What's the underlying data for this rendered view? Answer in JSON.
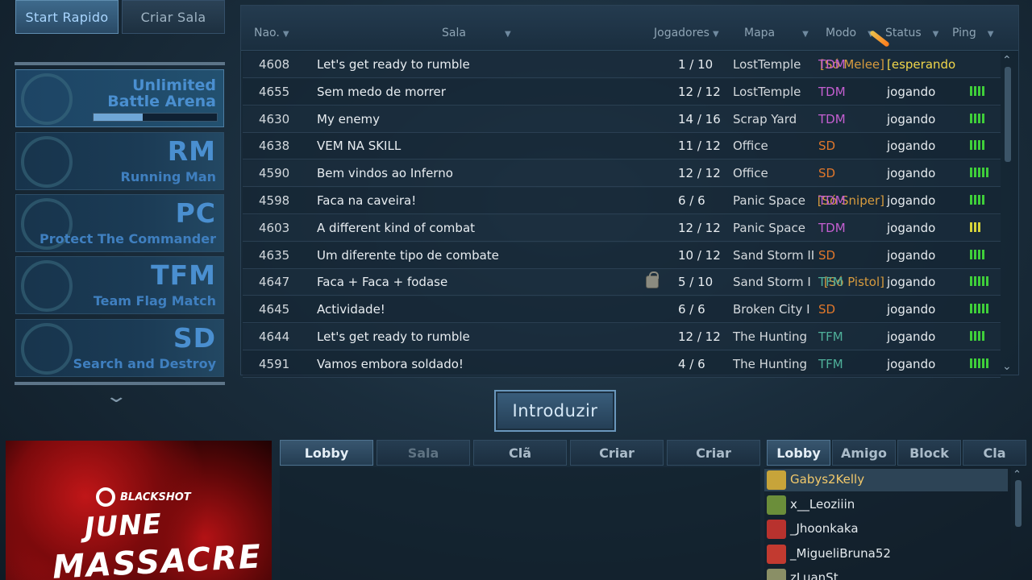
{
  "mode_buttons": {
    "quick_start": "Start Rapido",
    "create_room": "Criar Sala"
  },
  "sidebar": {
    "cards": [
      {
        "line1": "Unlimited",
        "line2": "Battle Arena",
        "progress": 0.4,
        "emblem": "infinity-emblem-icon"
      },
      {
        "big": "RM",
        "sub": "Running Man",
        "emblem": "dollar-pin-icon"
      },
      {
        "big": "PC",
        "sub": "Protect The Commander",
        "emblem": "star-shield-icon"
      },
      {
        "big": "TFM",
        "sub": "Team Flag Match",
        "emblem": "flag-shield-icon"
      },
      {
        "big": "SD",
        "sub": "Search and Destroy",
        "emblem": "bomb-target-icon"
      }
    ]
  },
  "room_table": {
    "headers": {
      "no": "Nao.",
      "room": "Sala",
      "players": "Jogadores",
      "map": "Mapa",
      "mode": "Modo",
      "status": "Status",
      "ping": "Ping"
    },
    "rows": [
      {
        "no": "4608",
        "name": "Let's get ready to rumble",
        "restrict": "[Só Melee]",
        "players": "1 / 10",
        "map": "LostTemple",
        "mode": "TDM",
        "status": "[esperando",
        "ping": 0
      },
      {
        "no": "4655",
        "name": "Sem medo de morrer",
        "restrict": "",
        "players": "12 / 12",
        "map": "LostTemple",
        "mode": "TDM",
        "status": "jogando",
        "ping": 4
      },
      {
        "no": "4630",
        "name": "My enemy",
        "restrict": "",
        "players": "14 / 16",
        "map": "Scrap Yard",
        "mode": "TDM",
        "status": "jogando",
        "ping": 4
      },
      {
        "no": "4638",
        "name": "VEM NA SKILL",
        "restrict": "",
        "players": "11 / 12",
        "map": "Office",
        "mode": "SD",
        "status": "jogando",
        "ping": 4
      },
      {
        "no": "4590",
        "name": "Bem vindos ao Inferno",
        "restrict": "",
        "players": "12 / 12",
        "map": "Office",
        "mode": "SD",
        "status": "jogando",
        "ping": 5
      },
      {
        "no": "4598",
        "name": "Faca na caveira!",
        "restrict": "[Só Sniper]",
        "players": "6 / 6",
        "map": "Panic Space",
        "mode": "TDM",
        "status": "jogando",
        "ping": 4
      },
      {
        "no": "4603",
        "name": "A different kind of combat",
        "restrict": "",
        "players": "12 / 12",
        "map": "Panic Space",
        "mode": "TDM",
        "status": "jogando",
        "ping": 3
      },
      {
        "no": "4635",
        "name": "Um diferente tipo de combate",
        "restrict": "",
        "players": "10 / 12",
        "map": "Sand Storm II",
        "mode": "SD",
        "status": "jogando",
        "ping": 4
      },
      {
        "no": "4647",
        "name": "Faca + Faca + fodase",
        "restrict": "[Só Pistol]",
        "locked": true,
        "players": "5 / 10",
        "map": "Sand Storm I",
        "mode": "TFM",
        "status": "jogando",
        "ping": 5
      },
      {
        "no": "4645",
        "name": "Actividade!",
        "restrict": "",
        "players": "6 / 6",
        "map": "Broken City I",
        "mode": "SD",
        "status": "jogando",
        "ping": 5
      },
      {
        "no": "4644",
        "name": "Let's get ready to rumble",
        "restrict": "",
        "players": "12 / 12",
        "map": "The Hunting",
        "mode": "TFM",
        "status": "jogando",
        "ping": 4
      },
      {
        "no": "4591",
        "name": "Vamos embora soldado!",
        "restrict": "",
        "players": "4 / 6",
        "map": "The Hunting",
        "mode": "TFM",
        "status": "jogando",
        "ping": 5
      }
    ],
    "mode_colors": {
      "TDM": "#c45fd1",
      "SD": "#e0772b",
      "TFM": "#4fb09a"
    },
    "status_colors": {
      "waiting": "#f0d64a",
      "playing": "#e6ebef"
    },
    "ping_colors": {
      "good": "#3fcf3a",
      "medium": "#d6d33a"
    }
  },
  "enter_button": "Introduzir",
  "banner": {
    "logo_text": "BLACKSHOT",
    "line1": "JUNE",
    "line2": "MASSACRE"
  },
  "chat_tabs": [
    {
      "label": "Lobby",
      "state": "active"
    },
    {
      "label": "Sala",
      "state": "disabled"
    },
    {
      "label": "Clã",
      "state": "normal"
    },
    {
      "label": "Criar",
      "state": "normal"
    },
    {
      "label": "Criar",
      "state": "normal"
    }
  ],
  "friend_tabs": [
    {
      "label": "Lobby",
      "state": "active"
    },
    {
      "label": "Amigo",
      "state": "normal"
    },
    {
      "label": "Block",
      "state": "normal"
    },
    {
      "label": "Cla",
      "state": "normal"
    }
  ],
  "players": [
    {
      "name": "Gabys2Kelly",
      "selected": true,
      "rank_color": "#c7a43a"
    },
    {
      "name": "x__Leoziiin",
      "selected": false,
      "rank_color": "#6b8e3a"
    },
    {
      "name": "_Jhoonkaka",
      "selected": false,
      "rank_color": "#b8322e"
    },
    {
      "name": "_MigueliBruna52",
      "selected": false,
      "rank_color": "#c23a30"
    },
    {
      "name": "zLuanSt",
      "selected": false,
      "rank_color": "#8a8f66"
    }
  ]
}
